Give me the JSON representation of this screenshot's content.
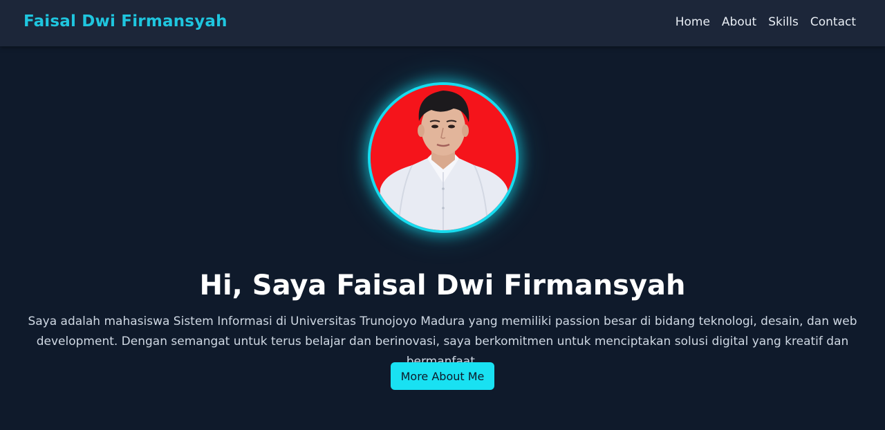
{
  "navbar": {
    "brand": "Faisal Dwi Firmansyah",
    "links": [
      "Home",
      "About",
      "Skills",
      "Contact"
    ]
  },
  "hero": {
    "avatar_alt": "profile-photo",
    "title": "Hi, Saya Faisal Dwi Firmansyah",
    "description": "Saya adalah mahasiswa Sistem Informasi di Universitas Trunojoyo Madura yang memiliki passion besar di bidang teknologi, desain, dan web development. Dengan semangat untuk terus belajar dan berinovasi, saya berkomitmen untuk menciptakan solusi digital yang kreatif dan bermanfaat.",
    "cta_label": "More About Me"
  },
  "colors": {
    "background": "#0f1a2b",
    "navbar": "#1c2639",
    "accent": "#19e1f2",
    "brand": "#1fc6df",
    "photo_background": "#f5141b"
  }
}
